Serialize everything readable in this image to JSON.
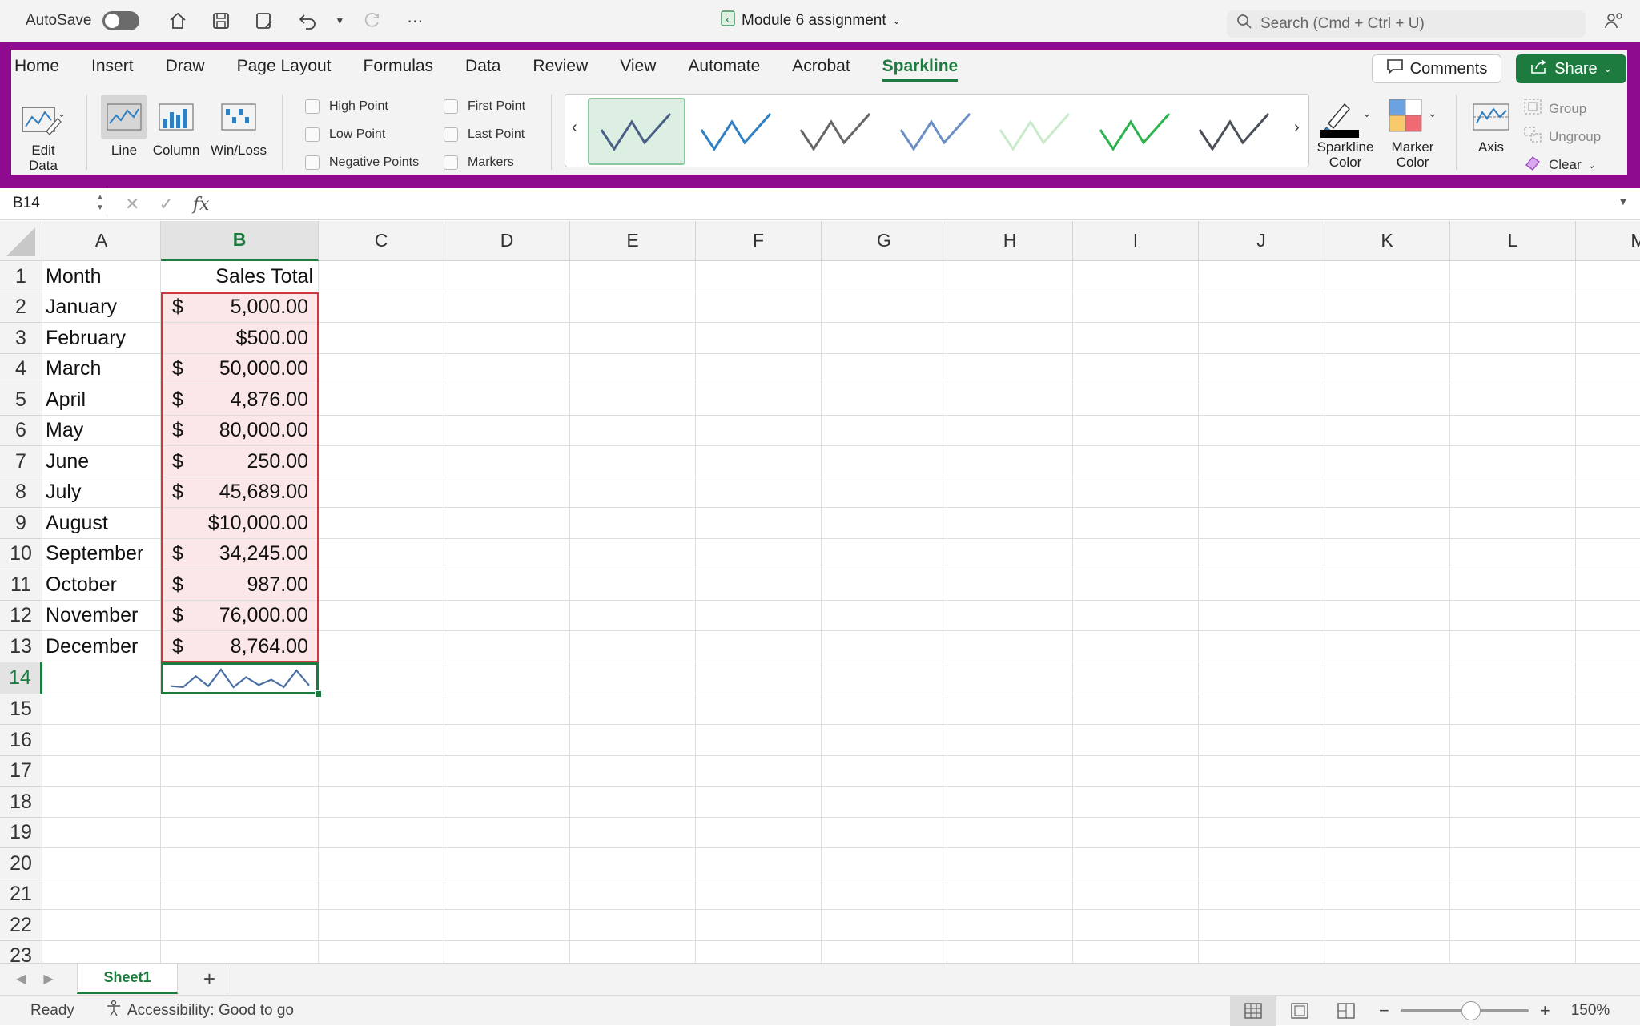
{
  "titlebar": {
    "autosave_label": "AutoSave",
    "document_title": "Module 6 assignment",
    "search_placeholder": "Search (Cmd + Ctrl + U)"
  },
  "ribbon": {
    "tabs": [
      "Home",
      "Insert",
      "Draw",
      "Page Layout",
      "Formulas",
      "Data",
      "Review",
      "View",
      "Automate",
      "Acrobat",
      "Sparkline"
    ],
    "active_tab": "Sparkline",
    "comments_label": "Comments",
    "share_label": "Share",
    "edit_data_label_1": "Edit",
    "edit_data_label_2": "Data",
    "type_line": "Line",
    "type_column": "Column",
    "type_winloss": "Win/Loss",
    "show": {
      "high_point": "High Point",
      "low_point": "Low Point",
      "negative_points": "Negative Points",
      "first_point": "First Point",
      "last_point": "Last Point",
      "markers": "Markers"
    },
    "style_colors": [
      "#4a5f86",
      "#2f7fc1",
      "#666666",
      "#6b8fc4",
      "#c9eacb",
      "#2db34e",
      "#4a4f5a"
    ],
    "sparkline_color_label_1": "Sparkline",
    "sparkline_color_label_2": "Color",
    "marker_color_label_1": "Marker",
    "marker_color_label_2": "Color",
    "axis_label": "Axis",
    "group_label": "Group",
    "ungroup_label": "Ungroup",
    "clear_label": "Clear"
  },
  "formula_bar": {
    "name_box": "B14",
    "fx": "fx",
    "formula": ""
  },
  "grid": {
    "columns": [
      "A",
      "B",
      "C",
      "D",
      "E",
      "F",
      "G",
      "H",
      "I",
      "J",
      "K",
      "L",
      "M"
    ],
    "rows": [
      "1",
      "2",
      "3",
      "4",
      "5",
      "6",
      "7",
      "8",
      "9",
      "10",
      "11",
      "12",
      "13",
      "14",
      "15",
      "16",
      "17",
      "18",
      "19",
      "20",
      "21",
      "22",
      "23"
    ],
    "header_a": "Month",
    "header_b": "Sales Total",
    "months": [
      "January",
      "February",
      "March",
      "April",
      "May",
      "June",
      "July",
      "August",
      "September",
      "October",
      "November",
      "December"
    ],
    "sales_display": [
      {
        "sym": "$",
        "amt": "5,000.00"
      },
      {
        "sym": "",
        "amt": "$500.00"
      },
      {
        "sym": "$",
        "amt": "50,000.00"
      },
      {
        "sym": "$",
        "amt": "4,876.00"
      },
      {
        "sym": "$",
        "amt": "80,000.00"
      },
      {
        "sym": "$",
        "amt": "250.00"
      },
      {
        "sym": "$",
        "amt": "45,689.00"
      },
      {
        "sym": "",
        "amt": "$10,000.00"
      },
      {
        "sym": "$",
        "amt": "34,245.00"
      },
      {
        "sym": "$",
        "amt": "987.00"
      },
      {
        "sym": "$",
        "amt": "76,000.00"
      },
      {
        "sym": "$",
        "amt": "8,764.00"
      }
    ],
    "sparkline_values": [
      5000,
      500,
      50000,
      4876,
      80000,
      250,
      45689,
      10000,
      34245,
      987,
      76000,
      8764
    ],
    "sparkline_color": "#4a6fa5",
    "selected_cell": "B14"
  },
  "sheets": {
    "active": "Sheet1",
    "add_label": "+"
  },
  "status": {
    "ready": "Ready",
    "accessibility": "Accessibility: Good to go",
    "zoom": "150%",
    "zoom_level": 0.55
  },
  "colors": {
    "accent_green": "#1e7b3f",
    "ribbon_highlight": "#8e0a8e",
    "selection_red": "#d0383f"
  }
}
